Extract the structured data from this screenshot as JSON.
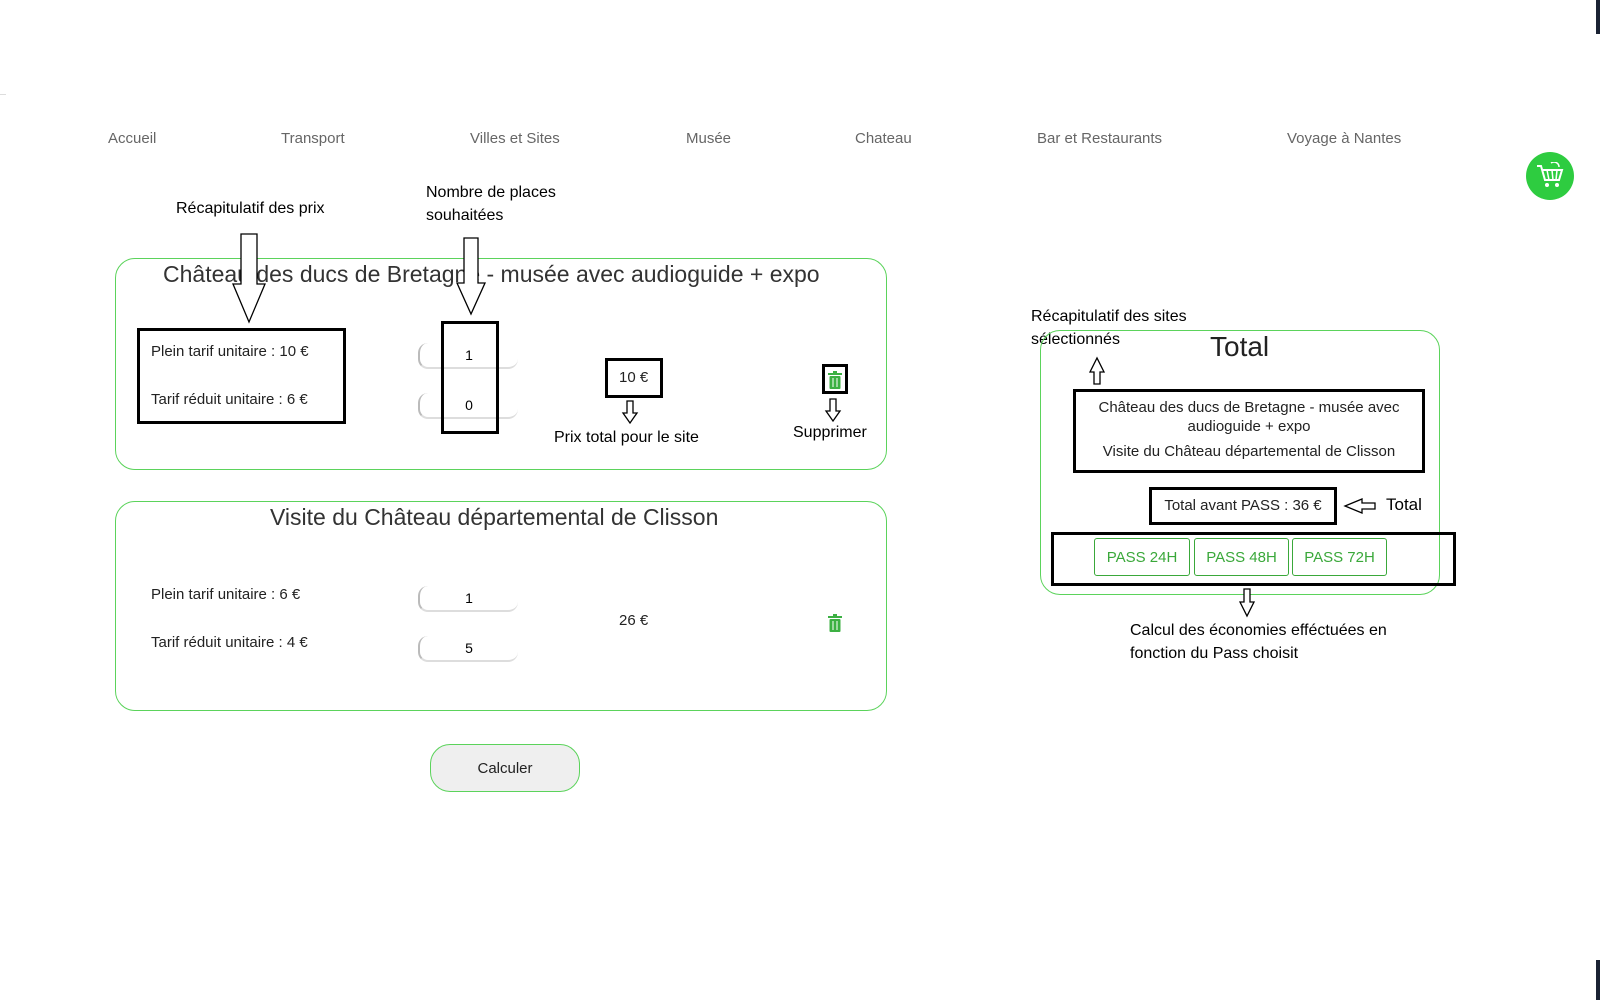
{
  "nav": {
    "items": [
      "Accueil",
      "Transport",
      "Villes et Sites",
      "Musée",
      "Chateau",
      "Bar et Restaurants",
      "Voyage à Nantes"
    ]
  },
  "cart": {
    "icon": "cart-icon",
    "color": "#2ecc40"
  },
  "annotations": {
    "recap_prix": "Récapitulatif des prix",
    "nb_places": "Nombre de places souhaitées",
    "prix_total_site": "Prix total pour le site",
    "supprimer": "Supprimer",
    "recap_sites": "Récapitulatif des sites sélectionnés",
    "total": "Total",
    "calcul_eco": "Calcul des économies efféctuées en fonction du Pass choisit"
  },
  "sites": [
    {
      "title": "Château des ducs de Bretagne - musée avec audioguide + expo",
      "plein": "Plein tarif unitaire : 10 €",
      "reduit": "Tarif réduit unitaire : 6 €",
      "qty_plein": "1",
      "qty_reduit": "0",
      "total": "10 €"
    },
    {
      "title": "Visite du Château départemental de Clisson",
      "plein": "Plein tarif unitaire : 6 €",
      "reduit": "Tarif réduit unitaire : 4 €",
      "qty_plein": "1",
      "qty_reduit": "5",
      "total": "26 €"
    }
  ],
  "calculer_label": "Calculer",
  "summary": {
    "title": "Total",
    "site1": "Château des ducs de Bretagne - musée avec audioguide + expo",
    "site2": "Visite du Château départemental de Clisson",
    "total_before_pass": "Total avant PASS : 36 €",
    "pass_buttons": [
      "PASS 24H",
      "PASS 48H",
      "PASS 72H"
    ]
  },
  "colors": {
    "accent": "#5bd35b",
    "pass": "#3aa83a",
    "trash": "#3cb043"
  }
}
